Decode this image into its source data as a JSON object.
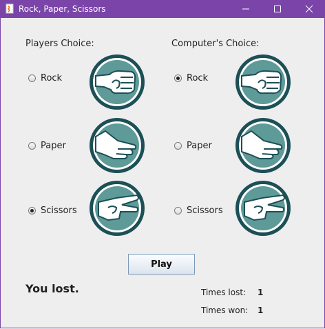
{
  "window": {
    "title": "Rock, Paper, Scissors",
    "accent_color": "#7a44a8",
    "controls": [
      "minimize-icon",
      "maximize-icon",
      "close-icon"
    ]
  },
  "player": {
    "heading": "Players Choice:",
    "options": [
      {
        "label": "Rock",
        "checked": false,
        "icon": "rock-fist-icon"
      },
      {
        "label": "Paper",
        "checked": false,
        "icon": "paper-hand-icon"
      },
      {
        "label": "Scissors",
        "checked": true,
        "icon": "scissors-hand-icon"
      }
    ]
  },
  "computer": {
    "heading": "Computer's Choice:",
    "options": [
      {
        "label": "Rock",
        "checked": true,
        "icon": "rock-fist-icon"
      },
      {
        "label": "Paper",
        "checked": false,
        "icon": "paper-hand-icon"
      },
      {
        "label": "Scissors",
        "checked": false,
        "icon": "scissors-hand-icon"
      }
    ]
  },
  "play_button": "Play",
  "result": "You lost.",
  "stats": {
    "lost_label": "Times lost:",
    "lost_value": "1",
    "won_label": "Times won:",
    "won_value": "1"
  },
  "icon_colors": {
    "ring": "#1c4f56",
    "fill": "#5e9a98"
  }
}
